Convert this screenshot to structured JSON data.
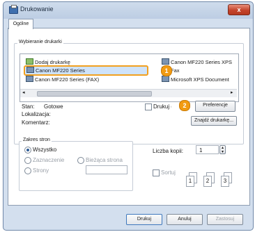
{
  "window": {
    "title": "Drukowanie",
    "close_label": "x"
  },
  "tabs": [
    {
      "label": "Ogólne"
    }
  ],
  "select_printer": {
    "legend": "Wybieranie drukarki",
    "printers_left": [
      "Dodaj drukarkę",
      "Canon MF220 Series",
      "Canon MF220 Series (FAX)"
    ],
    "printers_right": [
      "Canon MF220 Series XPS",
      "Fax",
      "Microsoft XPS Document"
    ],
    "selected": "Canon MF220 Series"
  },
  "callouts": {
    "one": "1",
    "two": "2"
  },
  "status": {
    "label": "Stan:",
    "value": "Gotowe"
  },
  "location": {
    "label": "Lokalizacja:"
  },
  "comment": {
    "label": "Komentarz:"
  },
  "print_to_file": "Drukuj do pliku",
  "preferences_button": "Preferencje",
  "find_printer_button": "Znajdź drukarkę...",
  "page_range": {
    "legend": "Zakres stron",
    "all": "Wszystko",
    "selection": "Zaznaczenie",
    "current_page": "Bieżąca strona",
    "pages": "Strony"
  },
  "copies": {
    "label": "Liczba kopii:",
    "value": "1",
    "collate": "Sortuj",
    "collate_pages": [
      "1",
      "2",
      "3"
    ]
  },
  "buttons": {
    "print": "Drukuj",
    "cancel": "Anuluj",
    "apply": "Zastosuj"
  }
}
